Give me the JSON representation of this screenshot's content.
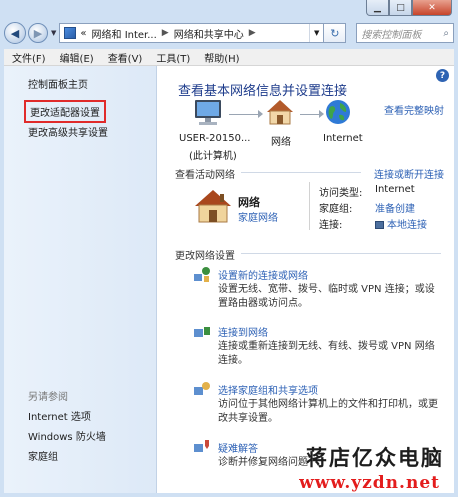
{
  "window": {
    "controls": {
      "minimize": "▁",
      "maximize": "□",
      "close": "✕"
    }
  },
  "address_bar": {
    "back_glyph": "◀",
    "forward_glyph": "▶",
    "prefix": "«",
    "crumb1": "网络和 Inter...",
    "crumb2": "网络和共享中心",
    "refresh_glyph": "↻",
    "search_placeholder": "搜索控制面板"
  },
  "menu": [
    "文件(F)",
    "编辑(E)",
    "查看(V)",
    "工具(T)",
    "帮助(H)"
  ],
  "left_pane": {
    "home": "控制面板主页",
    "change_adapter": "更改适配器设置",
    "change_sharing": "更改高级共享设置",
    "see_also": "另请参阅",
    "internet_options": "Internet 选项",
    "firewall": "Windows 防火墙",
    "homegroup": "家庭组"
  },
  "main": {
    "help_glyph": "?",
    "title": "查看基本网络信息并设置连接",
    "full_map": "查看完整映射",
    "map": {
      "computer_line1": "USER-20150...",
      "computer_line2": "(此计算机)",
      "network": "网络",
      "internet": "Internet"
    },
    "active_header": "查看活动网络",
    "connect_disconnect": "连接或断开连接",
    "active_network": {
      "name": "网络",
      "type": "家庭网络",
      "access_type_label": "访问类型:",
      "access_type_value": "Internet",
      "homegroup_label": "家庭组:",
      "homegroup_value": "准备创建",
      "connection_label": "连接:",
      "connection_value": "本地连接"
    },
    "change_header": "更改网络设置",
    "tasks": [
      {
        "title": "设置新的连接或网络",
        "desc": "设置无线、宽带、拨号、临时或 VPN 连接；或设置路由器或访问点。"
      },
      {
        "title": "连接到网络",
        "desc": "连接或重新连接到无线、有线、拨号或 VPN 网络连接。"
      },
      {
        "title": "选择家庭组和共享选项",
        "desc": "访问位于其他网络计算机上的文件和打印机，或更改共享设置。"
      },
      {
        "title": "疑难解答",
        "desc": "诊断并修复网络问题"
      }
    ]
  },
  "watermark": {
    "text": "蒋店亿众电脑",
    "url": "www.yzdn.net"
  },
  "colors": {
    "link": "#2d61b5",
    "title": "#1e3c8c",
    "highlight_box": "#e02b2b",
    "watermark_url": "#e31c1c"
  }
}
